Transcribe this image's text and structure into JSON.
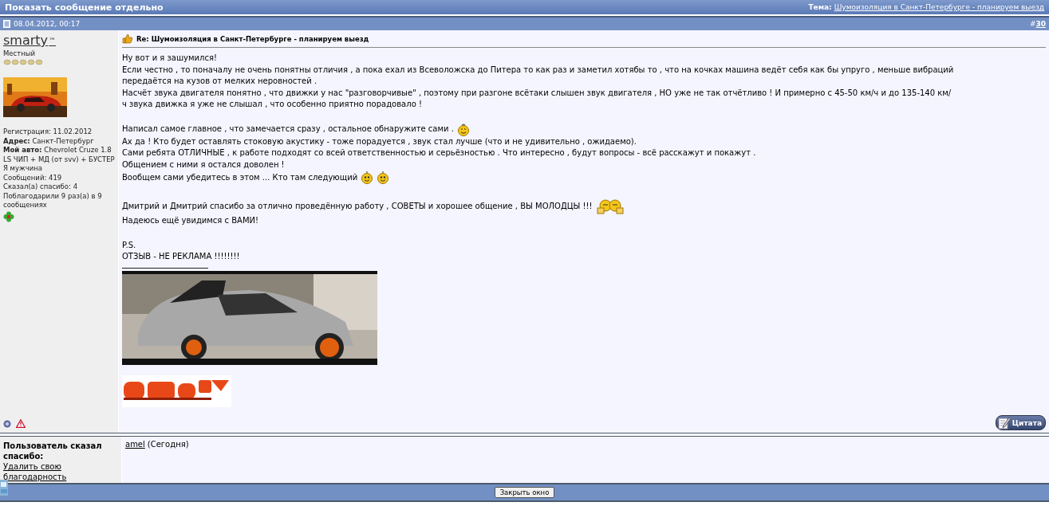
{
  "title_bar": {
    "title": "Показать сообщение отдельно",
    "topic_label": "Тема:",
    "topic_link": "Шумоизоляция в Санкт-Петербурге - планируем выезд"
  },
  "post": {
    "date": "08.04.2012, 00:17",
    "number_prefix": "#",
    "number": "30",
    "author": {
      "name": "smarty",
      "name_mark": "™",
      "rank": "Местный",
      "details": [
        "Регистрация: 11.02.2012",
        "**Адрес:** Санкт-Петербург",
        "**Мой авто:** Chevrolet Cruze 1.8 LS ЧИП + МД (от svv) + БУСТЕР",
        "Я мужчина",
        "Сообщений: 419",
        "Сказал(а) спасибо: 4",
        "Поблагодарили 9 раз(а) в 9 сообщениях"
      ]
    },
    "subject": "Re: Шумоизоляция в Санкт-Петербурге - планируем выезд",
    "paragraphs": [
      {
        "lines": [
          {
            "text": "Ну вот и я зашумился!"
          },
          {
            "text": "Если честно , то поначалу не очень понятны отличия , а пока ехал из Всеволожска до Питера то как раз и заметил хотябы то , что на кочках машина ведёт себя как бы упруго , меньше вибраций передаётся на кузов от мелких неровностей ."
          },
          {
            "text": "Насчёт звука двигателя понятно , что движки у нас \"разговорчивые\" , поэтому при разгоне всётаки слышен звук двигателя , НО уже не так отчётливо ! И примерно с 45-50 км/ч и до 135-140 км/ч звука движка я уже не слышал , что особенно приятно порадовало !"
          }
        ]
      },
      {
        "lines": [
          {
            "text": "Написал самое главное , что замечается сразу , остальное обнаружите сами .",
            "emoticons": [
              {
                "kind": "wink"
              }
            ]
          },
          {
            "text": "Ах да ! Кто будет оставлять стоковую акустику - тоже порадуется , звук стал лучше (что и не удивительно , ожидаемо)."
          },
          {
            "text": "Сами ребята ОТЛИЧНЫЕ , к работе подходят со всей ответственностью и серьёзностью . Что интересно , будут вопросы - всё расскажут и покажут ."
          },
          {
            "text": "Общением с ними я остался доволен !"
          },
          {
            "text": "Вообщем сами убедитесь в этом ... Кто там следующий",
            "emoticons": [
              {
                "kind": "smile"
              },
              {
                "kind": "smile"
              }
            ]
          }
        ]
      },
      {
        "lines": [
          {
            "text": "Дмитрий и Дмитрий спасибо за отлично проведённую работу , СОВЕТЫ и хорошее общение , ВЫ МОЛОДЦЫ !!!",
            "emoticons": [
              {
                "kind": "cheers"
              }
            ]
          },
          {
            "text": "Надеюсь ещё увидимся с ВАМИ!"
          }
        ]
      },
      {
        "lines": [
          {
            "text": "P.S."
          },
          {
            "text": "ОТЗЫВ -  НЕ РЕКЛАМА !!!!!!!!"
          }
        ]
      }
    ],
    "quote_button": "Цитата"
  },
  "thanks": {
    "heading": "Пользователь сказал спасибо:",
    "remove_link": "Удалить свою благодарность",
    "users": [
      {
        "name": "amel",
        "when": "(Сегодня)"
      }
    ]
  },
  "close_button": "Закрыть окно"
}
